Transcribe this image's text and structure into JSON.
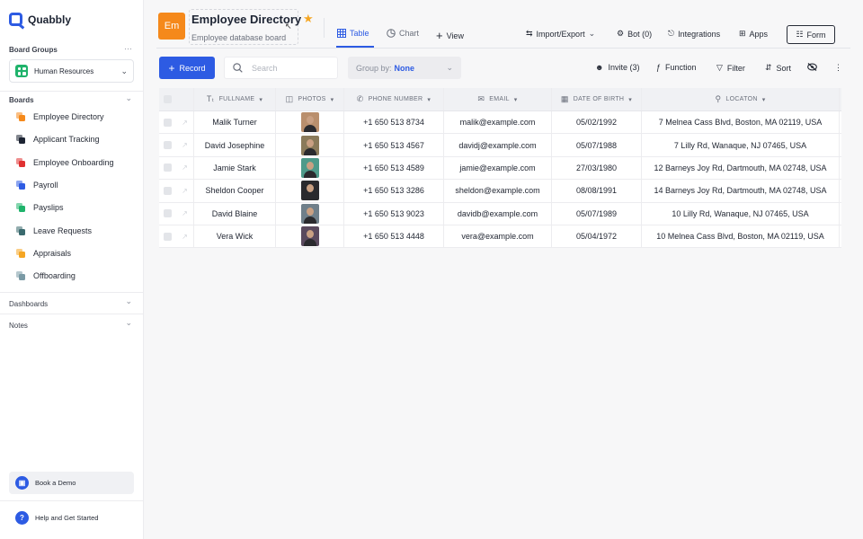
{
  "app": {
    "name": "Quabbly"
  },
  "sidebar": {
    "board_groups_label": "Board Groups",
    "board_groups_more": "···",
    "group_selected": "Human Resources",
    "boards_label": "Boards",
    "boards": [
      {
        "label": "Employee Directory",
        "color": "#f5891b"
      },
      {
        "label": "Applicant Tracking",
        "color": "#1d2433"
      },
      {
        "label": "Employee Onboarding",
        "color": "#e03131"
      },
      {
        "label": "Payroll",
        "color": "#2d5be3"
      },
      {
        "label": "Payslips",
        "color": "#1fb36b"
      },
      {
        "label": "Leave Requests",
        "color": "#3a6a6e"
      },
      {
        "label": "Appraisals",
        "color": "#f5a623"
      },
      {
        "label": "Offboarding",
        "color": "#7a9aa5"
      }
    ],
    "dashboards_label": "Dashboards",
    "notes_label": "Notes",
    "book_demo": "Book a Demo",
    "help": "Help and Get Started"
  },
  "header": {
    "avatar": "Em",
    "title": "Employee Directory",
    "subtitle": "Employee database board",
    "tabs": [
      {
        "label": "Table",
        "icon": "table-icon",
        "active": true
      },
      {
        "label": "Chart",
        "icon": "chart-icon",
        "active": false
      },
      {
        "label": "View",
        "icon": "plus-icon",
        "active": false
      }
    ],
    "actions": {
      "import_export": "Import/Export",
      "bot": "Bot (0)",
      "integrations": "Integrations",
      "apps": "Apps",
      "form": "Form"
    }
  },
  "toolbar": {
    "record": "Record",
    "search_placeholder": "Search",
    "group_by_label": "Group by:",
    "group_by_value": "None",
    "invite": "Invite (3)",
    "function": "Function",
    "filter": "Filter",
    "sort": "Sort"
  },
  "table": {
    "columns": [
      "FULLNAME",
      "PHOTOS",
      "PHONE NUMBER",
      "EMAIL",
      "DATE OF BIRTH",
      "LOCATON"
    ],
    "rows": [
      {
        "name": "Malik Turner",
        "phone": "+1 650 513 8734",
        "email": "malik@example.com",
        "dob": "05/02/1992",
        "location": "7 Melnea Cass Blvd, Boston, MA 02119, USA",
        "photo_bg": "#b98f6d"
      },
      {
        "name": "David Josephine",
        "phone": "+1 650 513 4567",
        "email": "davidj@example.com",
        "dob": "05/07/1988",
        "location": "7 Lilly Rd, Wanaque, NJ 07465, USA",
        "photo_bg": "#8a7a5a"
      },
      {
        "name": "Jamie Stark",
        "phone": "+1 650 513 4589",
        "email": "jamie@example.com",
        "dob": "27/03/1980",
        "location": "12 Barneys Joy Rd, Dartmouth, MA 02748, USA",
        "photo_bg": "#4e9a8a"
      },
      {
        "name": "Sheldon Cooper",
        "phone": "+1 650 513 3286",
        "email": "sheldon@example.com",
        "dob": "08/08/1991",
        "location": "14 Barneys Joy Rd, Dartmouth, MA 02748, USA",
        "photo_bg": "#2a2a2e"
      },
      {
        "name": "David Blaine",
        "phone": "+1 650 513 9023",
        "email": "davidb@example.com",
        "dob": "05/07/1989",
        "location": "10 Lilly Rd, Wanaque, NJ 07465, USA",
        "photo_bg": "#6f7f8a"
      },
      {
        "name": "Vera Wick",
        "phone": "+1 650 513 4448",
        "email": "vera@example.com",
        "dob": "05/04/1972",
        "location": "10 Melnea Cass Blvd, Boston, MA 02119, USA",
        "photo_bg": "#5a4a5e"
      }
    ]
  }
}
